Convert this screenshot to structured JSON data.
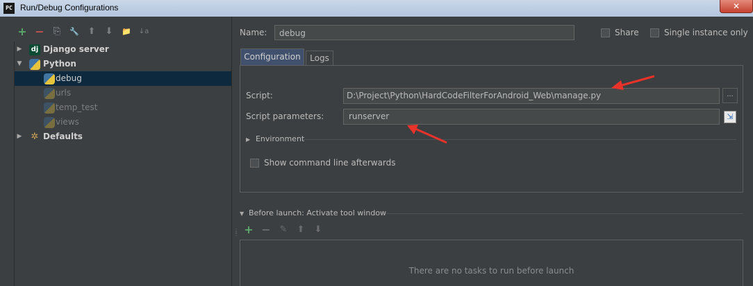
{
  "window": {
    "title": "Run/Debug Configurations",
    "app_icon": "PC",
    "close_glyph": "✕"
  },
  "toolbar": {
    "items": [
      {
        "name": "add",
        "glyph": "+"
      },
      {
        "name": "remove",
        "glyph": "−"
      },
      {
        "name": "copy",
        "glyph": "⎘"
      },
      {
        "name": "edit-defaults",
        "glyph": "🔧"
      },
      {
        "name": "move-up",
        "glyph": "⬆"
      },
      {
        "name": "move-down",
        "glyph": "⬇"
      },
      {
        "name": "folder",
        "glyph": "📁"
      },
      {
        "name": "sort",
        "glyph": "↓a"
      }
    ]
  },
  "tree": {
    "django": {
      "label": "Django server",
      "icon": "dj"
    },
    "python": {
      "label": "Python"
    },
    "configs": [
      "debug",
      "urls",
      "temp_test",
      "views"
    ],
    "defaults": {
      "label": "Defaults"
    }
  },
  "form": {
    "name_label": "Name:",
    "name_value": "debug",
    "share_label": "Share",
    "single_instance_label": "Single instance only",
    "tabs": {
      "configuration": "Configuration",
      "logs": "Logs"
    },
    "script_label": "Script:",
    "script_value": "D:\\Project\\Python\\HardCodeFilterForAndroid_Web\\manage.py",
    "browse_glyph": "...",
    "params_label": "Script parameters:",
    "params_value": "runserver",
    "environment_label": "Environment",
    "show_cmd_label": "Show command line afterwards"
  },
  "before_launch": {
    "label": "Before launch: Activate tool window",
    "empty_text": "There are no tasks to run before launch",
    "toolbar_glyphs": {
      "add": "+",
      "remove": "−",
      "edit": "✎",
      "up": "⬆",
      "down": "⬇"
    }
  },
  "colors": {
    "background": "#3c3f41",
    "selection": "#0d293e",
    "arrow": "#e8322a",
    "add_green": "#59a869",
    "remove_red": "#c75450"
  }
}
